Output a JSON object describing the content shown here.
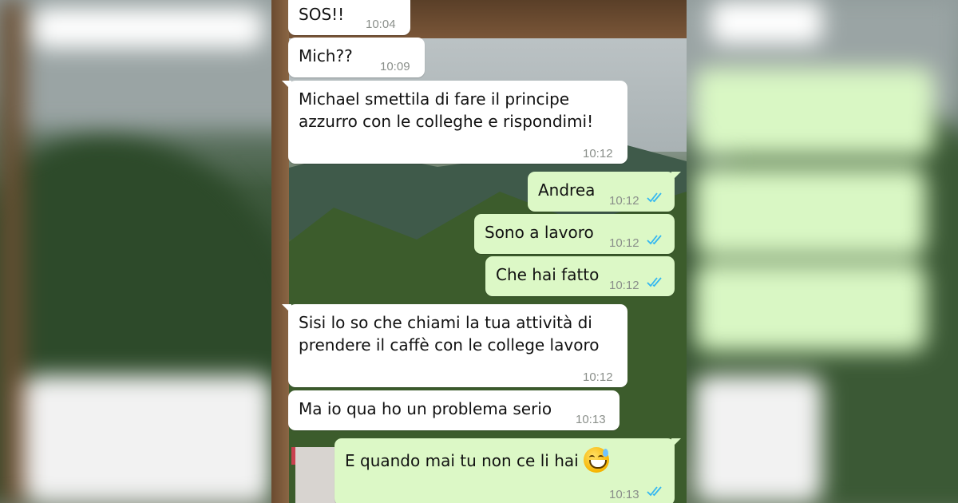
{
  "chat": {
    "messages": [
      {
        "direction": "in",
        "text": "SOS!!",
        "time": "10:04"
      },
      {
        "direction": "in",
        "text": "Mich??",
        "time": "10:09"
      },
      {
        "direction": "in",
        "text": "Michael smettila di fare il principe\nazzurro con le colleghe e rispondimi!",
        "time": "10:12"
      },
      {
        "direction": "out",
        "text": "Andrea",
        "time": "10:12",
        "status": "read"
      },
      {
        "direction": "out",
        "text": "Sono a lavoro",
        "time": "10:12",
        "status": "read"
      },
      {
        "direction": "out",
        "text": "Che hai fatto",
        "time": "10:12",
        "status": "read"
      },
      {
        "direction": "in",
        "text": "Sisi lo so che chiami la tua attività di\nprendere il caffè con le college lavoro",
        "time": "10:12"
      },
      {
        "direction": "in",
        "text": "Ma io qua ho un problema serio",
        "time": "10:13"
      },
      {
        "direction": "out",
        "text": "E quando mai tu non ce li hai",
        "time": "10:13",
        "status": "read",
        "emoji": "grinning-face-with-sweat"
      }
    ]
  },
  "colors": {
    "incoming_bubble": "#ffffff",
    "outgoing_bubble": "#dcf8c6",
    "timestamp": "#8a8f8a",
    "read_ticks": "#34b7f1"
  }
}
